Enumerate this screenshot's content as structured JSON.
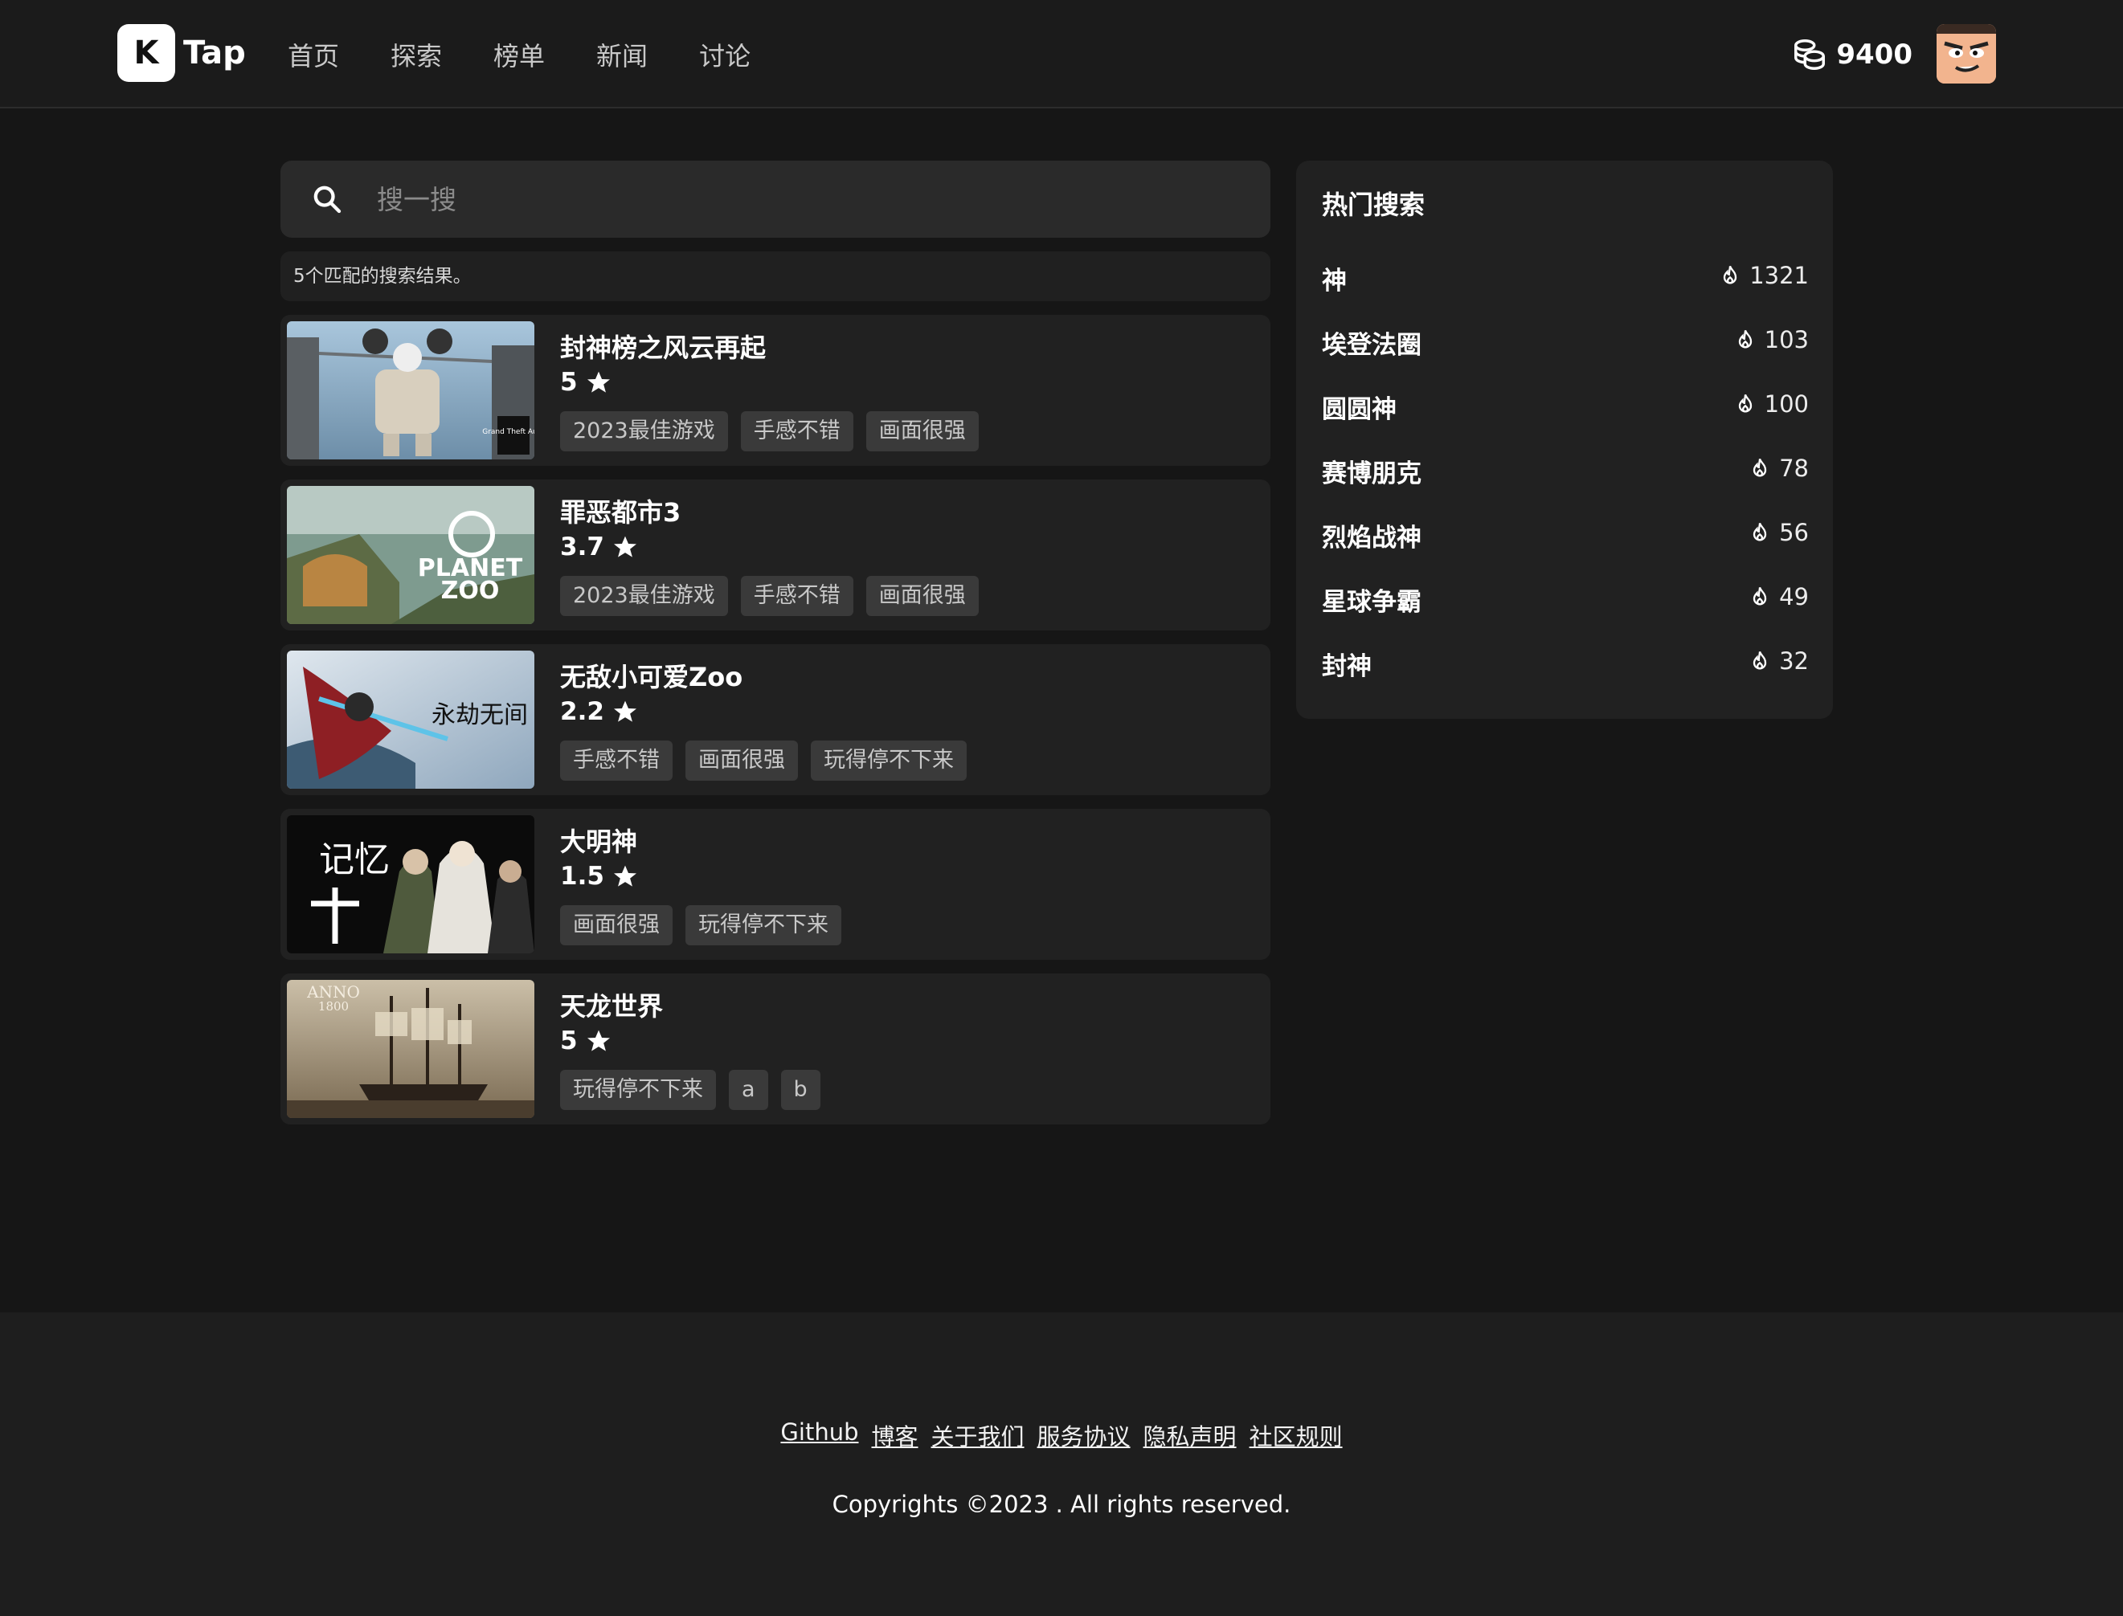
{
  "header": {
    "logo_letter": "K",
    "logo_text": "Tap",
    "nav": [
      "首页",
      "探索",
      "榜单",
      "新闻",
      "讨论"
    ],
    "coins": "9400"
  },
  "search": {
    "placeholder": "搜一搜",
    "result_count": "5个匹配的搜索结果。"
  },
  "results": [
    {
      "title": "封神榜之风云再起",
      "rating": "5",
      "tags": [
        "2023最佳游戏",
        "手感不错",
        "画面很强"
      ]
    },
    {
      "title": "罪恶都市3",
      "rating": "3.7",
      "tags": [
        "2023最佳游戏",
        "手感不错",
        "画面很强"
      ]
    },
    {
      "title": "无敌小可爱Zoo",
      "rating": "2.2",
      "tags": [
        "手感不错",
        "画面很强",
        "玩得停不下来"
      ]
    },
    {
      "title": "大明神",
      "rating": "1.5",
      "tags": [
        "画面很强",
        "玩得停不下来"
      ]
    },
    {
      "title": "天龙世界",
      "rating": "5",
      "tags": [
        "玩得停不下来",
        "a",
        "b"
      ]
    }
  ],
  "thumbnails": {
    "gta": {
      "badge": "Grand Theft Auto"
    },
    "zoo": {
      "line1": "PLANET",
      "line2": "ZOO"
    },
    "wuxia": {
      "text": "永劫无间"
    },
    "ming": {
      "text": "记忆"
    },
    "anno": {
      "line1": "ANNO",
      "line2": "1800"
    }
  },
  "hot_search": {
    "title": "热门搜索",
    "items": [
      {
        "name": "神",
        "count": "1321"
      },
      {
        "name": "埃登法圈",
        "count": "103"
      },
      {
        "name": "圆圆神",
        "count": "100"
      },
      {
        "name": "赛博朋克",
        "count": "78"
      },
      {
        "name": "烈焰战神",
        "count": "56"
      },
      {
        "name": "星球争霸",
        "count": "49"
      },
      {
        "name": "封神",
        "count": "32"
      }
    ]
  },
  "footer": {
    "links": [
      "Github",
      "博客",
      "关于我们",
      "服务协议",
      "隐私声明",
      "社区规则"
    ],
    "copyright": "Copyrights ©2023 . All rights reserved."
  },
  "colors": {
    "background": "#161616",
    "card": "#212121",
    "tag": "#3a3a3a",
    "text": "#ffffff"
  }
}
